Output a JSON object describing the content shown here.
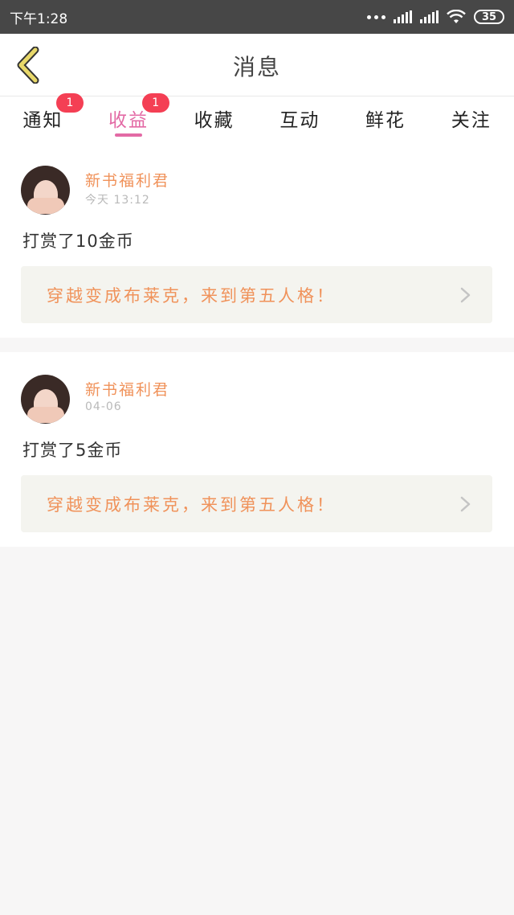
{
  "status_bar": {
    "time": "下午1:28",
    "battery": "35"
  },
  "header": {
    "title": "消息"
  },
  "tabs": [
    {
      "label": "通知",
      "badge": "1",
      "active": false
    },
    {
      "label": "收益",
      "badge": "1",
      "active": true
    },
    {
      "label": "收藏",
      "badge": "",
      "active": false
    },
    {
      "label": "互动",
      "badge": "",
      "active": false
    },
    {
      "label": "鲜花",
      "badge": "",
      "active": false
    },
    {
      "label": "关注",
      "badge": "",
      "active": false
    }
  ],
  "messages": [
    {
      "sender": "新书福利君",
      "time": "今天 13:12",
      "text": "打赏了10金币",
      "book": "穿越变成布莱克，来到第五人格！"
    },
    {
      "sender": "新书福利君",
      "time": "04-06",
      "text": "打赏了5金币",
      "book": "穿越变成布莱克，来到第五人格！"
    }
  ],
  "colors": {
    "accent_pink": "#e36aa5",
    "accent_orange": "#f0925a",
    "badge_red": "#f43f54",
    "back_arrow": "#e8d86a"
  }
}
